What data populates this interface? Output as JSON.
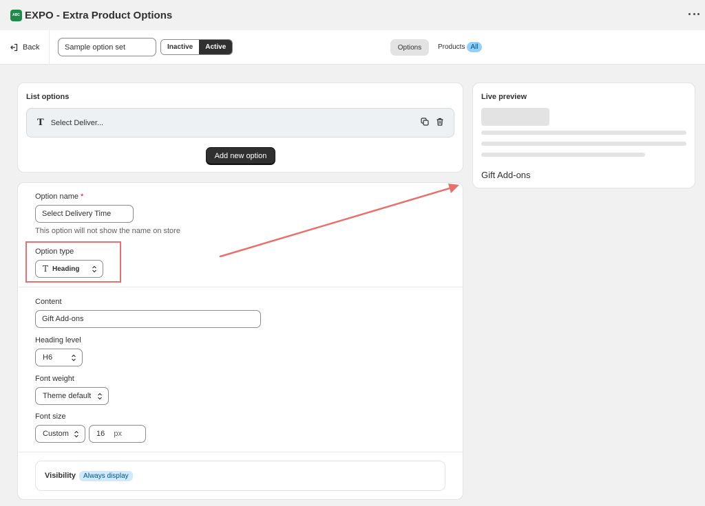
{
  "app": {
    "logo_text": "ABC",
    "title": "EXPO - Extra Product Options",
    "more_icon": "more-horizontal-icon"
  },
  "toolbar": {
    "back_label": "Back",
    "option_set_name": "Sample option set",
    "status_inactive": "Inactive",
    "status_active": "Active",
    "status_selected": "Active",
    "nav_options": "Options",
    "nav_products": "Products",
    "products_badge": "All"
  },
  "list_options": {
    "title": "List options",
    "items": [
      {
        "type_icon": "text-heading-icon",
        "label": "Select Deliver..."
      }
    ],
    "add_button": "Add new option"
  },
  "live_preview": {
    "title": "Live preview",
    "heading_text": "Gift Add-ons"
  },
  "option_editor": {
    "name_label": "Option name",
    "name_required_mark": "*",
    "name_value": "Select Delivery Time",
    "name_help": "This option will not show the name on store",
    "type_label": "Option type",
    "type_value": "Heading",
    "content_label": "Content",
    "content_value": "Gift Add-ons",
    "heading_level_label": "Heading level",
    "heading_level_value": "H6",
    "font_weight_label": "Font weight",
    "font_weight_value": "Theme default",
    "font_size_label": "Font size",
    "font_size_mode": "Custom",
    "font_size_value": "16",
    "font_size_unit": "px",
    "visibility_label": "Visibility",
    "visibility_value": "Always display"
  },
  "colors": {
    "accent_dark": "#303030",
    "annotation_red": "#e8706c",
    "badge_blue": "#91d0ff",
    "logo_green": "#1f8a4c"
  }
}
